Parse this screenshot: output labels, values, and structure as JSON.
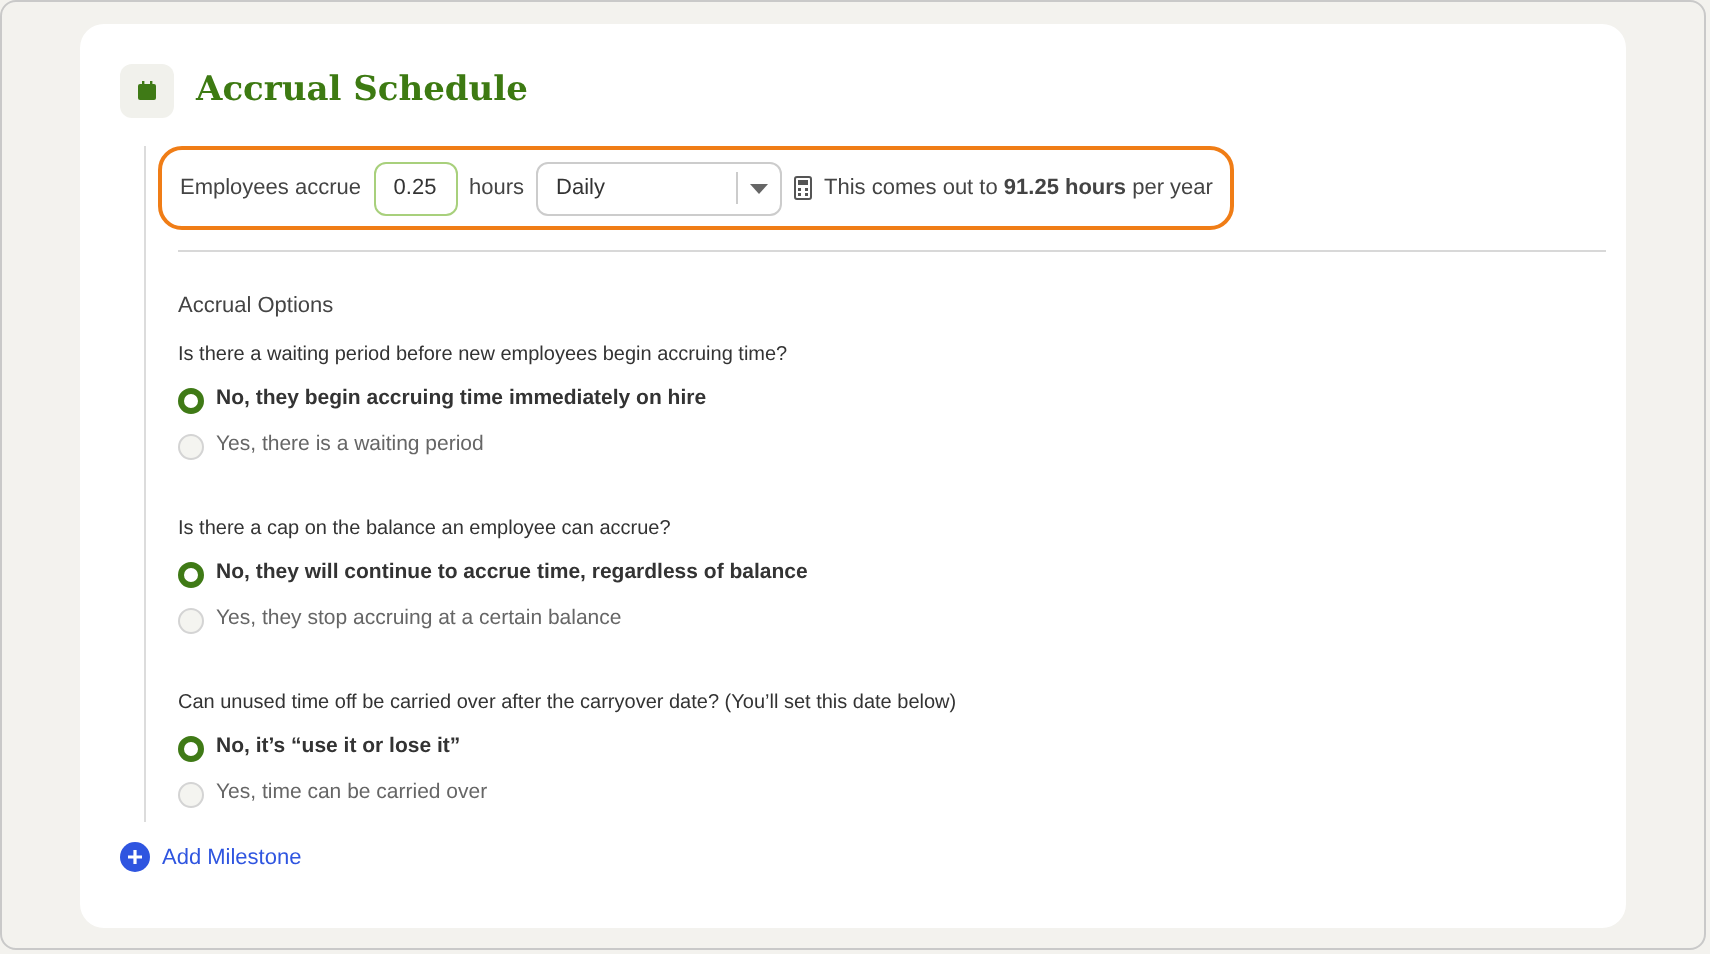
{
  "section": {
    "title": "Accrual Schedule"
  },
  "accrual_rule": {
    "prefix": "Employees accrue",
    "amount": "0.25",
    "unit": "hours",
    "frequency": "Daily",
    "summary": "This comes out to **91.25 hours** per year",
    "highlighted": true
  },
  "options": {
    "heading": "Accrual Options",
    "questions": [
      {
        "question": "Is there a waiting period before new employees begin accruing time?",
        "choices": [
          {
            "label": "No, they begin accruing time immediately on hire",
            "selected": true
          },
          {
            "label": "Yes, there is a waiting period",
            "selected": false
          }
        ]
      },
      {
        "question": "Is there a cap on the balance an employee can accrue?",
        "choices": [
          {
            "label": "No, they will continue to accrue time, regardless of balance",
            "selected": true
          },
          {
            "label": "Yes, they stop accruing at a certain balance",
            "selected": false
          }
        ]
      },
      {
        "question": "Can unused time off be carried over after the carryover date? (You’ll set this date below)",
        "choices": [
          {
            "label": "No, it’s “use it or lose it”",
            "selected": true
          },
          {
            "label": "Yes, time can be carried over",
            "selected": false
          }
        ]
      }
    ]
  },
  "add_button": {
    "label": "Add Milestone"
  }
}
